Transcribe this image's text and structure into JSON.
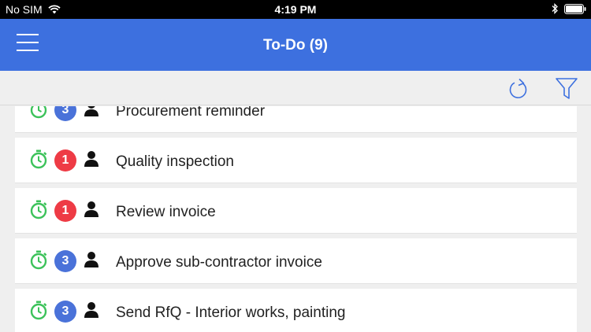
{
  "status_bar": {
    "carrier": "No SIM",
    "time": "4:19 PM"
  },
  "header": {
    "title": "To-Do (9)",
    "menu_icon": "hamburger-menu-icon"
  },
  "toolbar": {
    "refresh_icon": "refresh-icon",
    "filter_icon": "filter-icon"
  },
  "colors": {
    "header_bg": "#3d70df",
    "timer_green": "#3cc25a",
    "badge_red": "#ee3b45",
    "badge_blue": "#4a72d9",
    "toolbar_icon": "#3d70df"
  },
  "tasks": [
    {
      "priority": "3",
      "priority_color": "#4a72d9",
      "title": "Procurement reminder"
    },
    {
      "priority": "1",
      "priority_color": "#ee3b45",
      "title": "Quality inspection"
    },
    {
      "priority": "1",
      "priority_color": "#ee3b45",
      "title": "Review invoice"
    },
    {
      "priority": "3",
      "priority_color": "#4a72d9",
      "title": "Approve sub-contractor invoice"
    },
    {
      "priority": "3",
      "priority_color": "#4a72d9",
      "title": "Send RfQ - Interior works, painting"
    }
  ]
}
